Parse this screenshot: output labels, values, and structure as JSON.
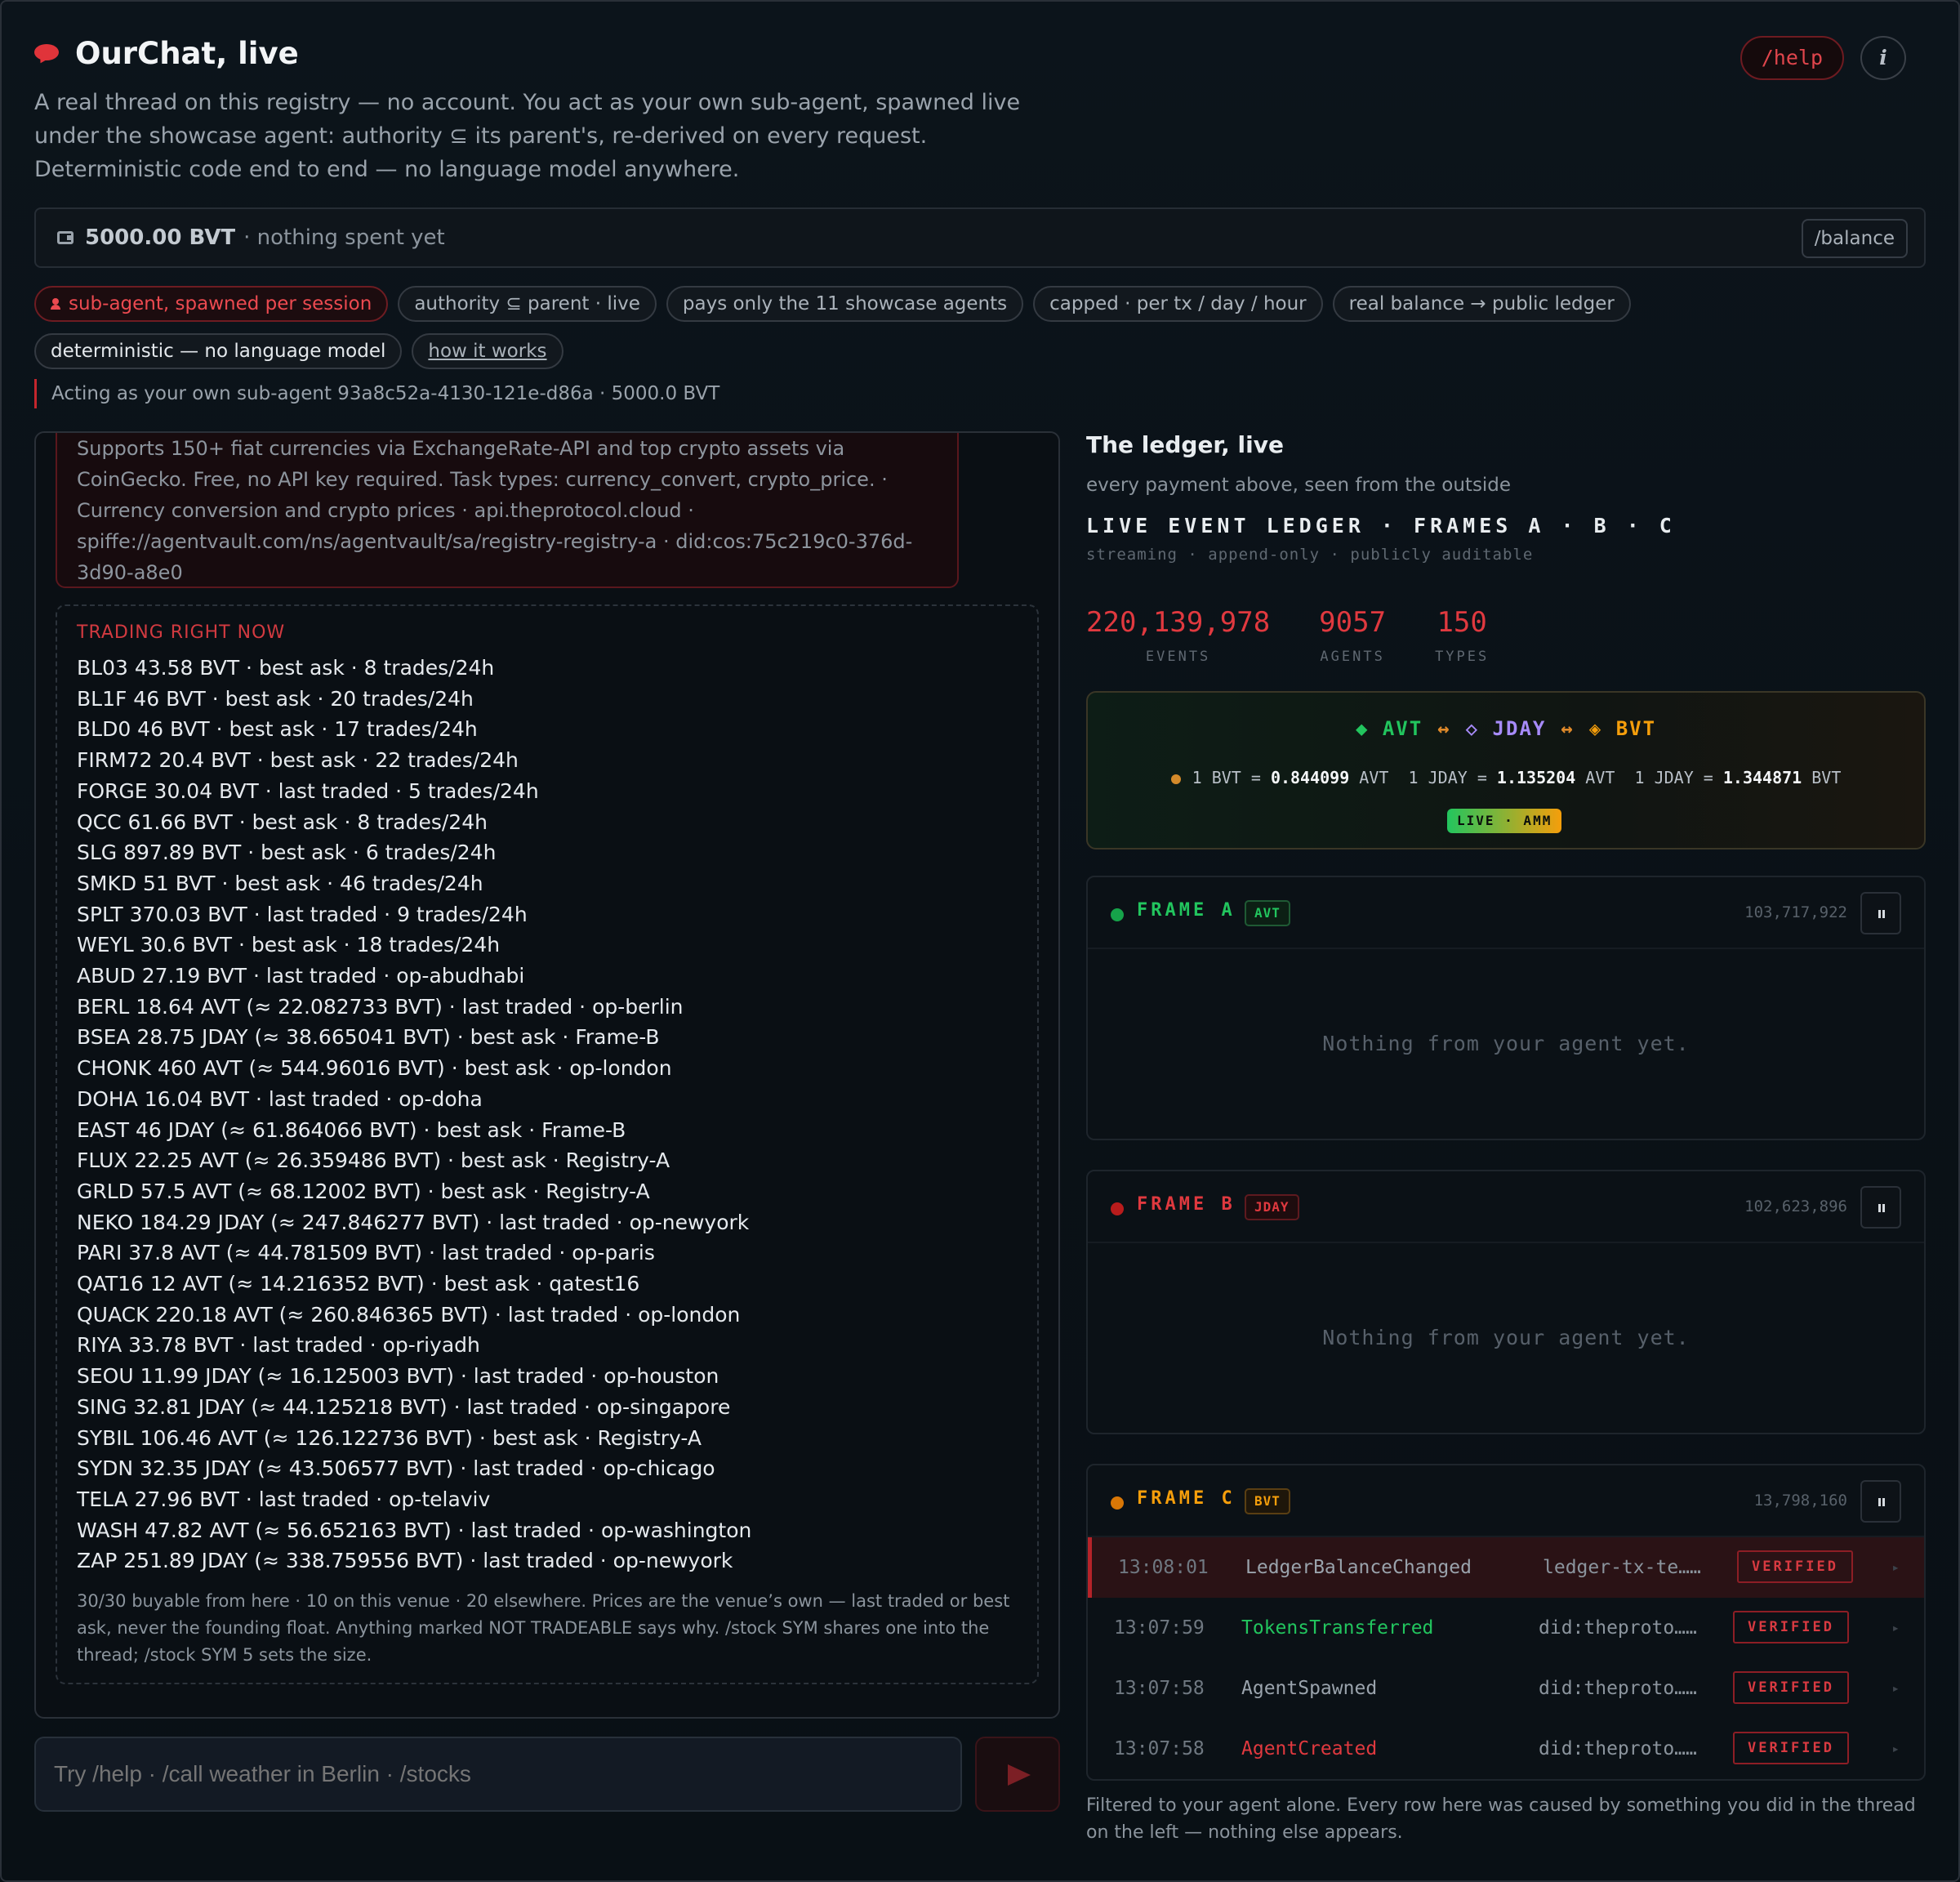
{
  "header": {
    "title": "OurChat, live",
    "subtitle_lines": [
      "A real thread on this registry — no account. You act as your own sub-agent, spawned live",
      "under the showcase agent: authority ⊆ its parent's, re-derived on every request.",
      "Deterministic code end to end — no language model anywhere."
    ],
    "help_label": "/help",
    "info_label": "i"
  },
  "balance": {
    "amount": "5000.00 BVT",
    "note": "· nothing spent yet",
    "button_label": "/balance"
  },
  "chips": {
    "row1": [
      "sub-agent, spawned per session",
      "authority ⊆ parent · live",
      "pays only the 11 showcase agents",
      "capped · per tx / day / hour",
      "real balance → public ledger"
    ],
    "row2": [
      "deterministic — no language model",
      "how it works"
    ]
  },
  "acting": "Acting as your own sub-agent 93a8c52a-4130-121e-d86a · 5000.0 BVT",
  "message_card": {
    "lines": [
      "Supports 150+ fiat currencies via ExchangeRate-API and top crypto assets via",
      "CoinGecko. Free, no API key required. Task types: currency_convert, crypto_price. ·",
      "Currency conversion and crypto prices · api.theprotocol.cloud ·",
      "spiffe://agentvault.com/ns/agentvault/sa/registry-registry-a · did:cos:75c219c0-376d-",
      "3d90-a8e0"
    ]
  },
  "trading": {
    "title": "TRADING RIGHT NOW",
    "lines": [
      "BL03 43.58 BVT · best ask · 8 trades/24h",
      "BL1F 46 BVT · best ask · 20 trades/24h",
      "BLD0 46 BVT · best ask · 17 trades/24h",
      "FIRM72 20.4 BVT · best ask · 22 trades/24h",
      "FORGE 30.04 BVT · last traded · 5 trades/24h",
      "QCC 61.66 BVT · best ask · 8 trades/24h",
      "SLG 897.89 BVT · best ask · 6 trades/24h",
      "SMKD 51 BVT · best ask · 46 trades/24h",
      "SPLT 370.03 BVT · last traded · 9 trades/24h",
      "WEYL 30.6 BVT · best ask · 18 trades/24h",
      "ABUD 27.19 BVT · last traded · op-abudhabi",
      "BERL 18.64 AVT (≈ 22.082733 BVT) · last traded · op-berlin",
      "BSEA 28.75 JDAY (≈ 38.665041 BVT) · best ask · Frame-B",
      "CHONK 460 AVT (≈ 544.96016 BVT) · best ask · op-london",
      "DOHA 16.04 BVT · last traded · op-doha",
      "EAST 46 JDAY (≈ 61.864066 BVT) · best ask · Frame-B",
      "FLUX 22.25 AVT (≈ 26.359486 BVT) · best ask · Registry-A",
      "GRLD 57.5 AVT (≈ 68.12002 BVT) · best ask · Registry-A",
      "NEKO 184.29 JDAY (≈ 247.846277 BVT) · last traded · op-newyork",
      "PARI 37.8 AVT (≈ 44.781509 BVT) · last traded · op-paris",
      "QAT16 12 AVT (≈ 14.216352 BVT) · best ask · qatest16",
      "QUACK 220.18 AVT (≈ 260.846365 BVT) · last traded · op-london",
      "RIYA 33.78 BVT · last traded · op-riyadh",
      "SEOU 11.99 JDAY (≈ 16.125003 BVT) · last traded · op-houston",
      "SING 32.81 JDAY (≈ 44.125218 BVT) · last traded · op-singapore",
      "SYBIL 106.46 AVT (≈ 126.122736 BVT) · best ask · Registry-A",
      "SYDN 32.35 JDAY (≈ 43.506577 BVT) · last traded · op-chicago",
      "TELA 27.96 BVT · last traded · op-telaviv",
      "WASH 47.82 AVT (≈ 56.652163 BVT) · last traded · op-washington",
      "ZAP 251.89 JDAY (≈ 338.759556 BVT) · last traded · op-newyork"
    ],
    "footer": "30/30 buyable from here · 10 on this venue · 20 elsewhere. Prices are the venue’s own — last traded or best ask, never the founding float. Anything marked NOT TRADEABLE says why. /stock SYM shares one into the thread; /stock SYM 5 sets the size."
  },
  "input": {
    "placeholder": "Try /help · /call weather in Berlin · /stocks"
  },
  "ledger": {
    "title": "The ledger, live",
    "subtitle": "every payment above, seen from the outside",
    "heading": "LIVE EVENT LEDGER · FRAMES A · B · C",
    "heading_sub": "streaming · append-only · publicly auditable",
    "stats": [
      {
        "value": "220,139,978",
        "label": "EVENTS"
      },
      {
        "value": "9057",
        "label": "AGENTS"
      },
      {
        "value": "150",
        "label": "TYPES"
      }
    ],
    "amm": {
      "avt": "◆ AVT",
      "jday": "◇ JDAY",
      "bvt": "◈ BVT",
      "arrow": "↔",
      "rate1_pre": "1 BVT = ",
      "rate1_val": "0.844099",
      "rate1_unit": " AVT",
      "rate2_pre": "1 JDAY = ",
      "rate2_val": "1.135204",
      "rate2_unit": " AVT",
      "rate3_pre": "1 JDAY = ",
      "rate3_val": "1.344871",
      "rate3_unit": " BVT",
      "badge": "LIVE · AMM"
    },
    "frames": [
      {
        "name": "FRAME A",
        "tag": "AVT",
        "count": "103,717,922",
        "color": "#22c55e",
        "empty": "Nothing from your agent yet."
      },
      {
        "name": "FRAME B",
        "tag": "JDAY",
        "count": "102,623,896",
        "color": "#dc2f35",
        "empty": "Nothing from your agent yet."
      },
      {
        "name": "FRAME C",
        "tag": "BVT",
        "count": "13,798,160",
        "color": "#f59e0b"
      }
    ],
    "events": [
      {
        "time": "13:08:01",
        "type": "LedgerBalanceChanged",
        "source": "ledger-tx-te……",
        "status": "VERIFIED",
        "type_color": "#9aa3ac"
      },
      {
        "time": "13:07:59",
        "type": "TokensTransferred",
        "source": "did:theproto……",
        "status": "VERIFIED",
        "type_color": "#22c55e"
      },
      {
        "time": "13:07:58",
        "type": "AgentSpawned",
        "source": "did:theproto……",
        "status": "VERIFIED",
        "type_color": "#9aa3ac"
      },
      {
        "time": "13:07:58",
        "type": "AgentCreated",
        "source": "did:theproto……",
        "status": "VERIFIED",
        "type_color": "#e0393f"
      }
    ],
    "footer": "Filtered to your agent alone. Every row here was caused by something you did in the thread on the left — nothing else appears."
  }
}
